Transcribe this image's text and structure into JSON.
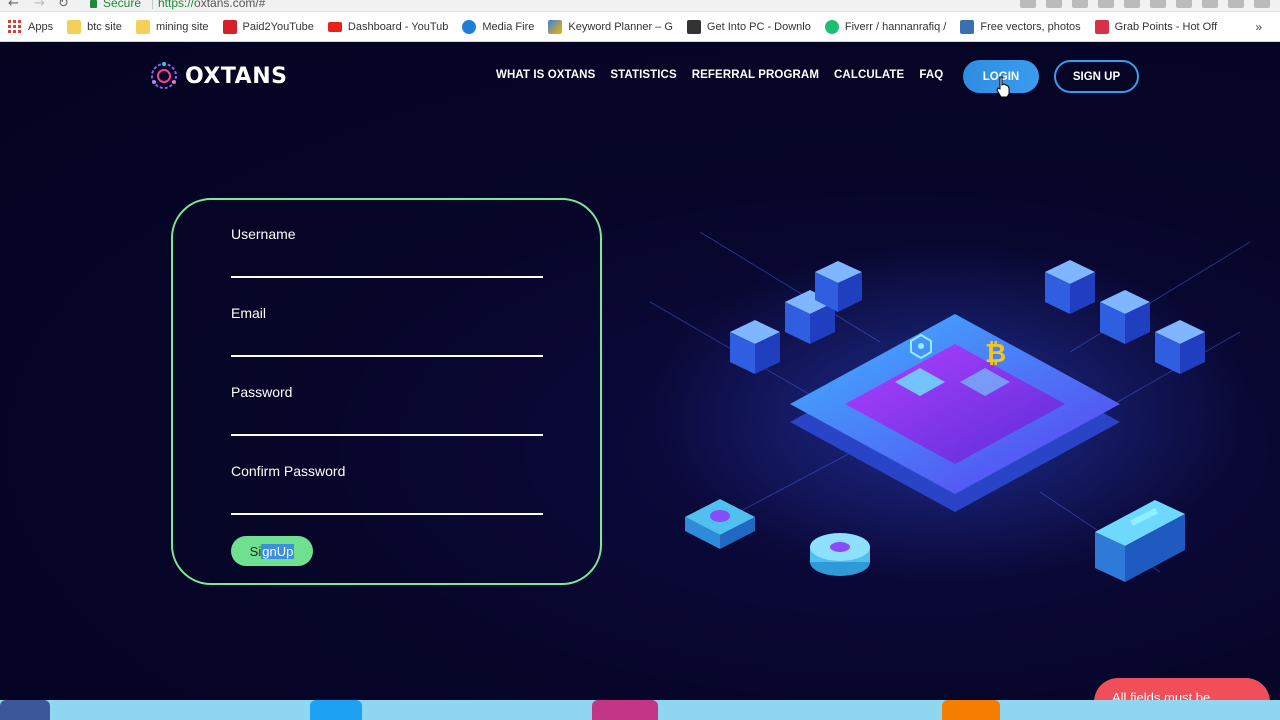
{
  "browser": {
    "secure_label": "Secure",
    "url_scheme": "https://",
    "url_rest": "oxtans.com/#",
    "bookmarks": [
      {
        "label": "Apps",
        "icon": "apps-grid-icon"
      },
      {
        "label": "btc site",
        "icon": "folder-icon"
      },
      {
        "label": "mining site",
        "icon": "folder-icon"
      },
      {
        "label": "Paid2YouTube",
        "icon": "paid2youtube-icon"
      },
      {
        "label": "Dashboard - YouTub",
        "icon": "youtube-icon"
      },
      {
        "label": "Media Fire",
        "icon": "mediafire-icon"
      },
      {
        "label": "Keyword Planner – G",
        "icon": "adwords-icon"
      },
      {
        "label": "Get Into PC - Downlo",
        "icon": "getintopc-icon"
      },
      {
        "label": "Fiverr / hannanrafiq /",
        "icon": "fiverr-icon"
      },
      {
        "label": "Free vectors, photos",
        "icon": "freepik-icon"
      },
      {
        "label": "Grab Points - Hot Off",
        "icon": "grabpoints-icon"
      }
    ],
    "more_label": "»"
  },
  "header": {
    "logo_text": "OXTANS",
    "nav": [
      {
        "label": "WHAT IS OXTANS"
      },
      {
        "label": "STATISTICS"
      },
      {
        "label": "REFERRAL PROGRAM"
      },
      {
        "label": "CALCULATE"
      },
      {
        "label": "FAQ"
      }
    ],
    "login_label": "LOGIN",
    "signup_label": "SIGN UP"
  },
  "form": {
    "fields": [
      {
        "label": "Username",
        "value": ""
      },
      {
        "label": "Email",
        "value": ""
      },
      {
        "label": "Password",
        "value": ""
      },
      {
        "label": "Confirm Password",
        "value": ""
      }
    ],
    "submit_pre": "Si",
    "submit_sel": "gnUp",
    "submit_label": "SignUp"
  },
  "toast": {
    "text": "All fields must be"
  },
  "colors": {
    "accent_green": "#7ee89a",
    "accent_blue": "#3a9cf0",
    "background": "#050422",
    "toast": "#f04e59"
  },
  "social": [
    {
      "icon": "facebook-icon"
    },
    {
      "icon": "twitter-icon"
    },
    {
      "icon": "instagram-icon"
    },
    {
      "icon": "blogger-icon"
    }
  ]
}
